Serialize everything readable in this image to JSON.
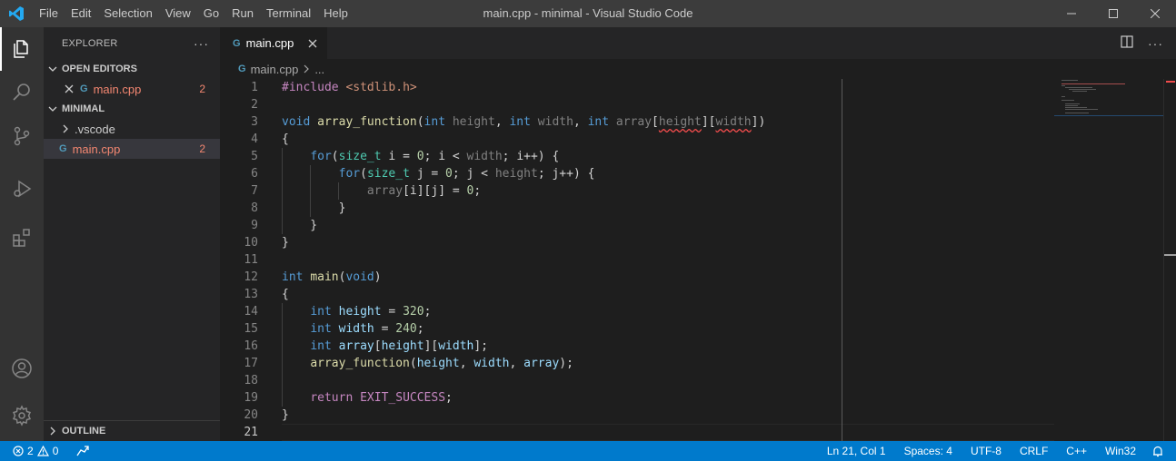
{
  "window": {
    "title": "main.cpp - minimal - Visual Studio Code",
    "menu": [
      "File",
      "Edit",
      "Selection",
      "View",
      "Go",
      "Run",
      "Terminal",
      "Help"
    ]
  },
  "sidebar": {
    "title": "EXPLORER",
    "open_editors": {
      "label": "OPEN EDITORS",
      "files": [
        {
          "name": "main.cpp",
          "badge": "2"
        }
      ]
    },
    "folder": {
      "label": "MINIMAL",
      "items": [
        {
          "name": ".vscode",
          "type": "folder"
        },
        {
          "name": "main.cpp",
          "type": "file",
          "badge": "2"
        }
      ]
    },
    "outline_label": "OUTLINE"
  },
  "editor": {
    "tab_label": "main.cpp",
    "breadcrumb": {
      "file": "main.cpp",
      "more": "..."
    },
    "lines": [
      "1",
      "2",
      "3",
      "4",
      "5",
      "6",
      "7",
      "8",
      "9",
      "10",
      "11",
      "12",
      "13",
      "14",
      "15",
      "16",
      "17",
      "18",
      "19",
      "20",
      "21"
    ],
    "code": {
      "l1a": "#include ",
      "l1b": "<stdlib.h>",
      "void": "void",
      "array_function": "array_function",
      "int": "int",
      "height": "height",
      "width": "width",
      "array": "array",
      "for": "for",
      "size_t": "size_t",
      "main": "main",
      "return": "return",
      "exit_success": "EXIT_SUCCESS",
      "n320": "320",
      "n240": "240",
      "n0": "0"
    }
  },
  "status": {
    "errors": "2",
    "warnings": "0",
    "position": "Ln 21, Col 1",
    "spaces": "Spaces: 4",
    "encoding": "UTF-8",
    "eol": "CRLF",
    "language": "C++",
    "platform": "Win32"
  },
  "colors": {
    "accent": "#007acc",
    "error": "#f48771"
  }
}
